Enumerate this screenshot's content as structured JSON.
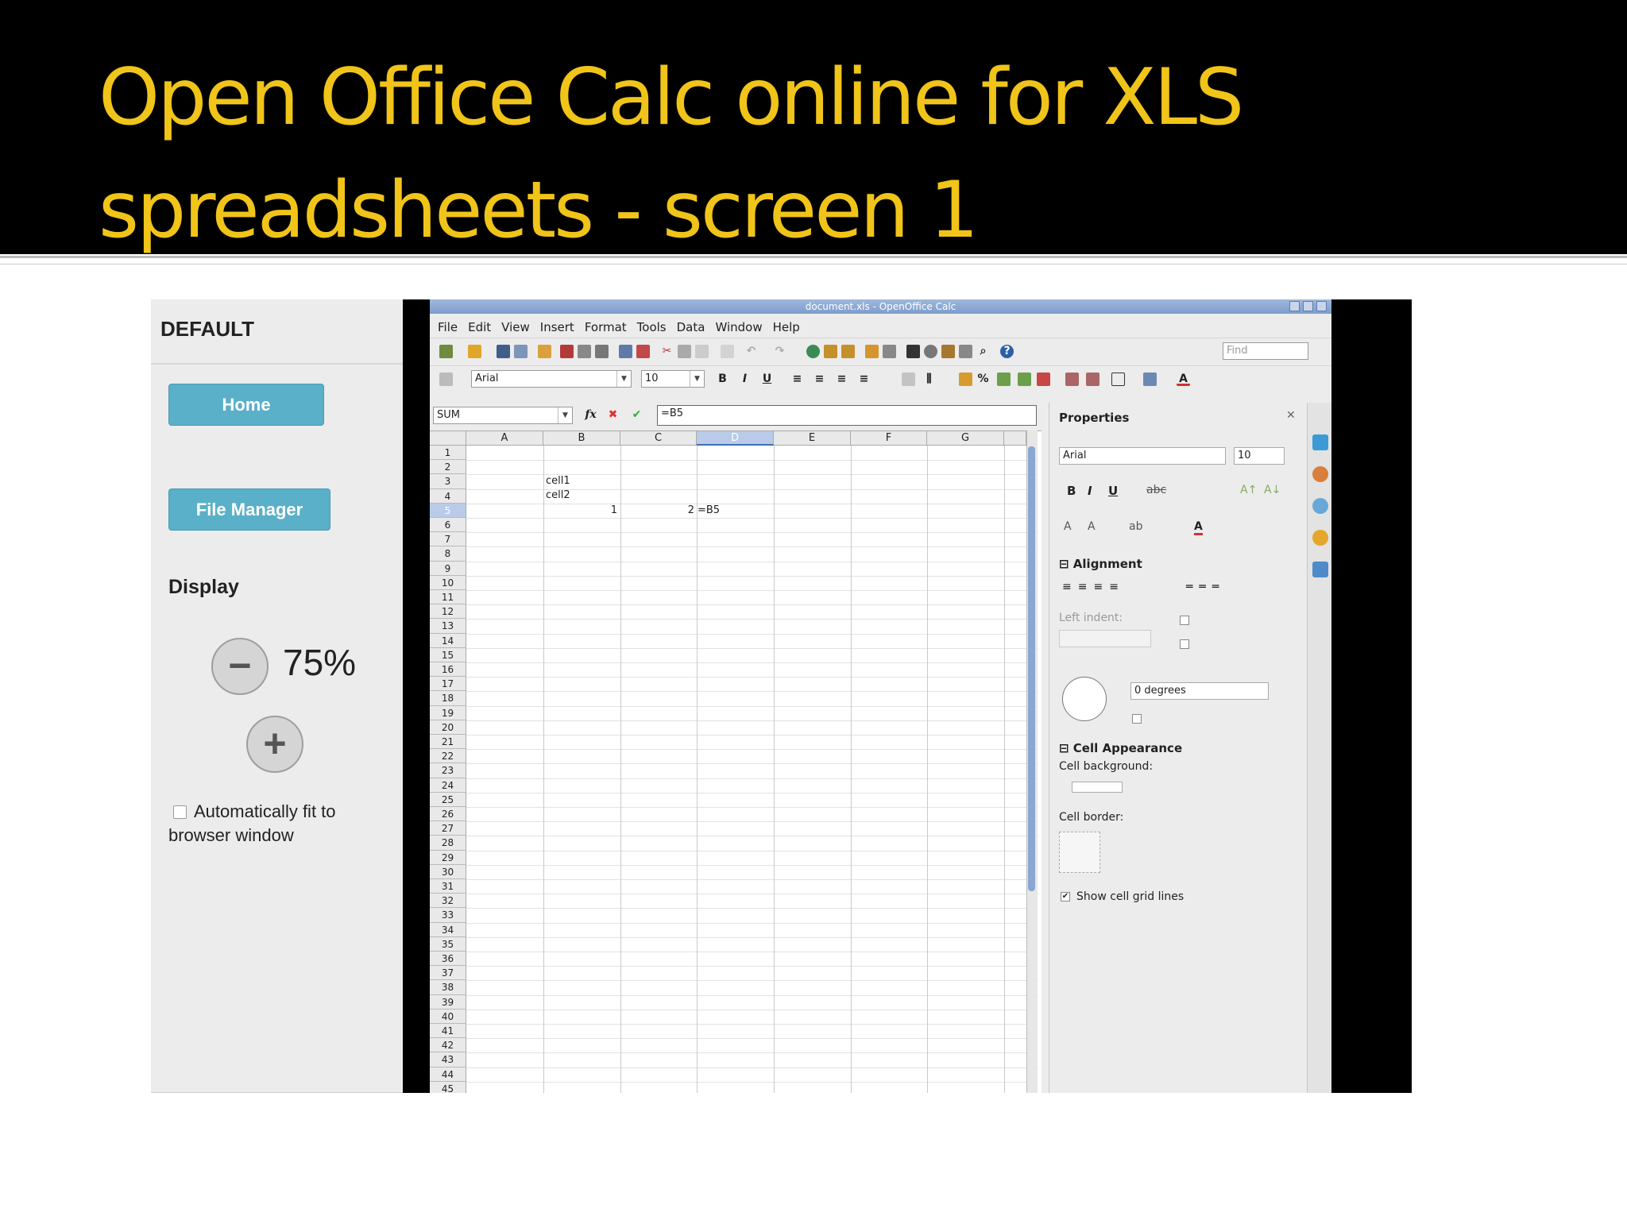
{
  "slide": {
    "title": "Open Office Calc online for XLS spreadsheets - screen 1"
  },
  "left_panel": {
    "title": "DEFAULT",
    "home_label": "Home",
    "file_manager_label": "File Manager",
    "display_label": "Display",
    "zoom_out_glyph": "−",
    "zoom_value": "75%",
    "zoom_in_glyph": "+",
    "autofit_label": "Automatically fit to browser window"
  },
  "app": {
    "window_title": "document.xls - OpenOffice Calc",
    "menu": [
      "File",
      "Edit",
      "View",
      "Insert",
      "Format",
      "Tools",
      "Data",
      "Window",
      "Help"
    ],
    "find_placeholder": "Find",
    "font_name": "Arial",
    "font_size": "10",
    "name_box": "SUM",
    "formula": "=B5",
    "toolbar_bold": "B",
    "toolbar_italic": "I",
    "toolbar_underline": "U",
    "columns": [
      "A",
      "B",
      "C",
      "D",
      "E",
      "F",
      "G"
    ],
    "cells": {
      "B3": "cell1",
      "B4": "cell2",
      "B5": "1",
      "C5": "2",
      "D5": "=B5"
    },
    "row_count": 45
  },
  "properties": {
    "title": "Properties",
    "font_name": "Arial",
    "font_size": "10",
    "bold": "B",
    "italic": "I",
    "underline": "U",
    "alignment_header": "Alignment",
    "left_indent_label": "Left indent:",
    "degrees_value": "0 degrees",
    "cell_appearance_header": "Cell Appearance",
    "cell_background_label": "Cell background:",
    "cell_border_label": "Cell border:",
    "show_grid_label": "Show cell grid lines"
  },
  "colors": {
    "title": "#f0c419",
    "button": "#5ab0c8",
    "selected_header": "#b9cbe8"
  }
}
